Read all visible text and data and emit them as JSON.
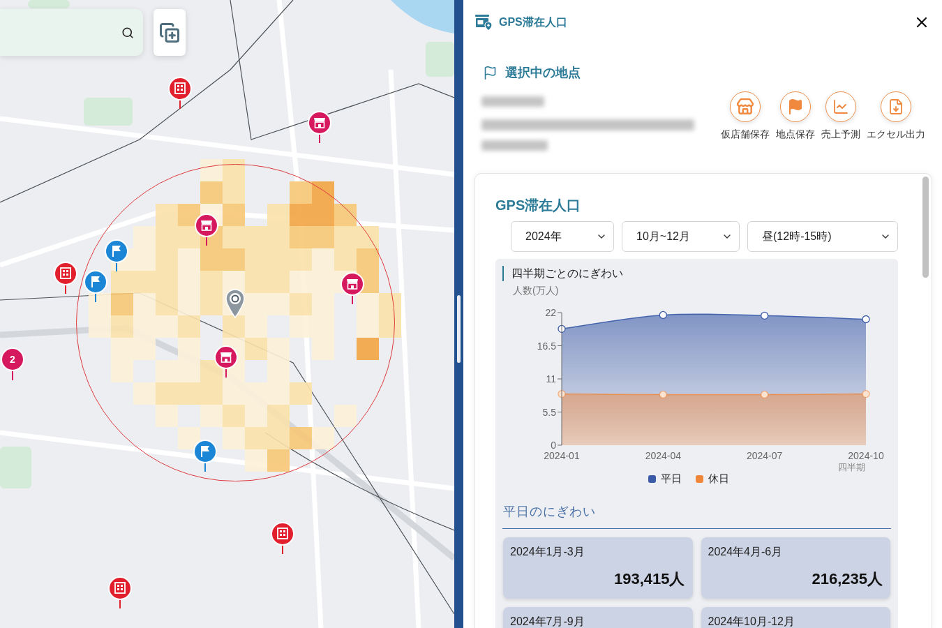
{
  "map": {
    "markers": [
      {
        "kind": "building"
      },
      {
        "kind": "building"
      },
      {
        "kind": "building"
      },
      {
        "kind": "building"
      },
      {
        "kind": "store"
      },
      {
        "kind": "store"
      },
      {
        "kind": "store"
      },
      {
        "kind": "store"
      },
      {
        "kind": "flag"
      },
      {
        "kind": "flag"
      },
      {
        "kind": "flag"
      },
      {
        "kind": "cluster",
        "label": "2"
      },
      {
        "kind": "location"
      }
    ]
  },
  "header": {
    "title": "GPS滞在人口"
  },
  "location": {
    "heading": "選択中の地点"
  },
  "actions": [
    {
      "kind": "store",
      "label": "仮店舗保存"
    },
    {
      "kind": "flag",
      "label": "地点保存"
    },
    {
      "kind": "chart",
      "label": "売上予測"
    },
    {
      "kind": "export",
      "label": "エクセル出力"
    }
  ],
  "card": {
    "title": "GPS滞在人口",
    "filters": [
      {
        "value": "2024年"
      },
      {
        "value": "10月~12月"
      },
      {
        "value": "昼(12時-15時)"
      }
    ],
    "chart": {
      "chart_data": {
        "type": "area",
        "title": "四半期ごとのにぎわい",
        "xlabel": "四半期",
        "ylabel": "人数(万人)",
        "categories": [
          "2024-01",
          "2024-04",
          "2024-07",
          "2024-10"
        ],
        "series": [
          {
            "name": "平日",
            "color": "#3a5ba8",
            "values": [
              19.3,
              21.6,
              21.5,
              20.9
            ]
          },
          {
            "name": "休日",
            "color": "#f0863a",
            "values": [
              8.5,
              8.4,
              8.4,
              8.5
            ]
          }
        ],
        "ylim": [
          0,
          22
        ],
        "yticks": [
          0,
          5.5,
          11,
          16.5,
          22
        ]
      }
    },
    "weekday": {
      "heading": "平日のにぎわい",
      "stats": [
        {
          "period": "2024年1月-3月",
          "value": "193,415人"
        },
        {
          "period": "2024年4月-6月",
          "value": "216,235人"
        },
        {
          "period": "2024年7月-9月"
        },
        {
          "period": "2024年10月-12月"
        }
      ]
    }
  }
}
